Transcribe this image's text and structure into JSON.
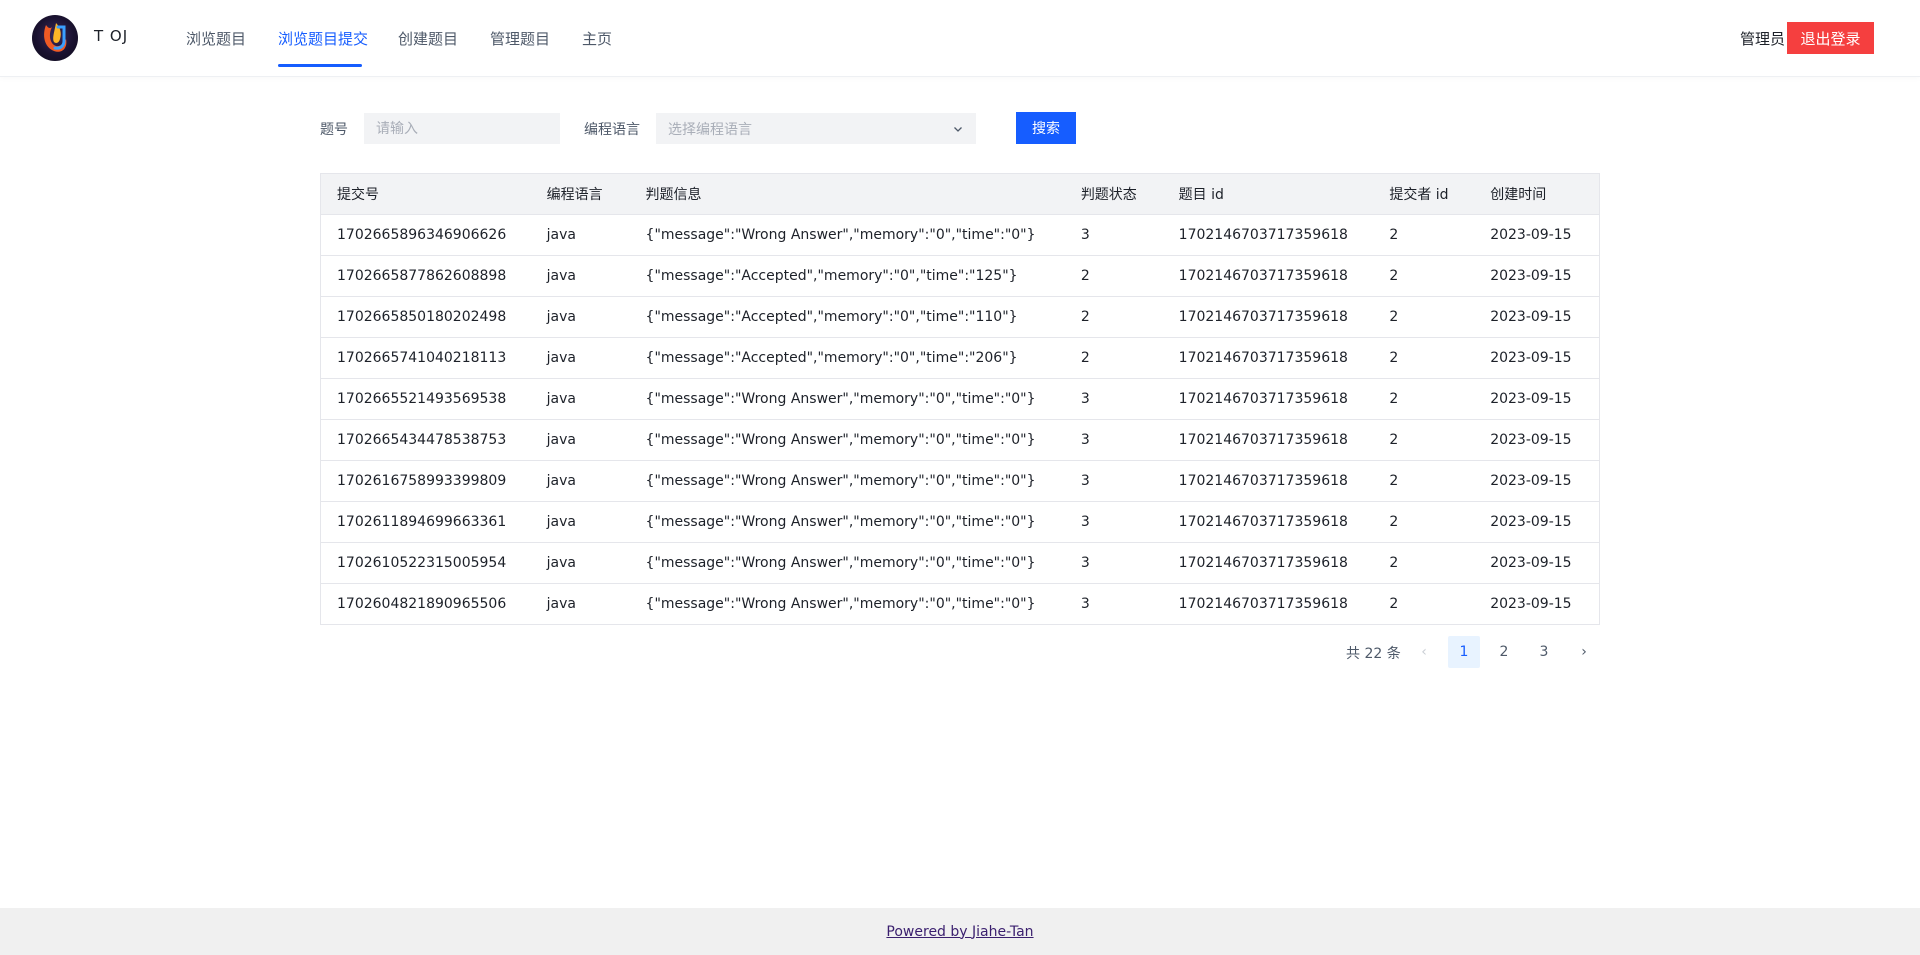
{
  "header": {
    "brand": "T OJ",
    "nav": [
      {
        "label": "浏览题目",
        "active": false
      },
      {
        "label": "浏览题目提交",
        "active": true
      },
      {
        "label": "创建题目",
        "active": false
      },
      {
        "label": "管理题目",
        "active": false
      },
      {
        "label": "主页",
        "active": false
      }
    ],
    "admin_label": "管理员",
    "logout_label": "退出登录"
  },
  "search": {
    "question_label": "题号",
    "question_placeholder": "请输入",
    "language_label": "编程语言",
    "language_placeholder": "选择编程语言",
    "search_label": "搜索"
  },
  "table": {
    "columns": [
      "提交号",
      "编程语言",
      "判题信息",
      "判题状态",
      "题目 id",
      "提交者 id",
      "创建时间"
    ],
    "rows": [
      [
        "1702665896346906626",
        "java",
        "{\"message\":\"Wrong Answer\",\"memory\":\"0\",\"time\":\"0\"}",
        "3",
        "1702146703717359618",
        "2",
        "2023-09-15"
      ],
      [
        "1702665877862608898",
        "java",
        "{\"message\":\"Accepted\",\"memory\":\"0\",\"time\":\"125\"}",
        "2",
        "1702146703717359618",
        "2",
        "2023-09-15"
      ],
      [
        "1702665850180202498",
        "java",
        "{\"message\":\"Accepted\",\"memory\":\"0\",\"time\":\"110\"}",
        "2",
        "1702146703717359618",
        "2",
        "2023-09-15"
      ],
      [
        "1702665741040218113",
        "java",
        "{\"message\":\"Accepted\",\"memory\":\"0\",\"time\":\"206\"}",
        "2",
        "1702146703717359618",
        "2",
        "2023-09-15"
      ],
      [
        "1702665521493569538",
        "java",
        "{\"message\":\"Wrong Answer\",\"memory\":\"0\",\"time\":\"0\"}",
        "3",
        "1702146703717359618",
        "2",
        "2023-09-15"
      ],
      [
        "1702665434478538753",
        "java",
        "{\"message\":\"Wrong Answer\",\"memory\":\"0\",\"time\":\"0\"}",
        "3",
        "1702146703717359618",
        "2",
        "2023-09-15"
      ],
      [
        "1702616758993399809",
        "java",
        "{\"message\":\"Wrong Answer\",\"memory\":\"0\",\"time\":\"0\"}",
        "3",
        "1702146703717359618",
        "2",
        "2023-09-15"
      ],
      [
        "1702611894699663361",
        "java",
        "{\"message\":\"Wrong Answer\",\"memory\":\"0\",\"time\":\"0\"}",
        "3",
        "1702146703717359618",
        "2",
        "2023-09-15"
      ],
      [
        "1702610522315005954",
        "java",
        "{\"message\":\"Wrong Answer\",\"memory\":\"0\",\"time\":\"0\"}",
        "3",
        "1702146703717359618",
        "2",
        "2023-09-15"
      ],
      [
        "1702604821890965506",
        "java",
        "{\"message\":\"Wrong Answer\",\"memory\":\"0\",\"time\":\"0\"}",
        "3",
        "1702146703717359618",
        "2",
        "2023-09-15"
      ]
    ]
  },
  "pagination": {
    "total_text": "共 22 条",
    "pages": [
      "1",
      "2",
      "3"
    ],
    "current": "1",
    "prev_icon": "‹",
    "next_icon": "›"
  },
  "footer": {
    "text": "Powered by Jiahe-Tan"
  },
  "colors": {
    "primary": "#165dff",
    "danger": "#f53f3f"
  }
}
